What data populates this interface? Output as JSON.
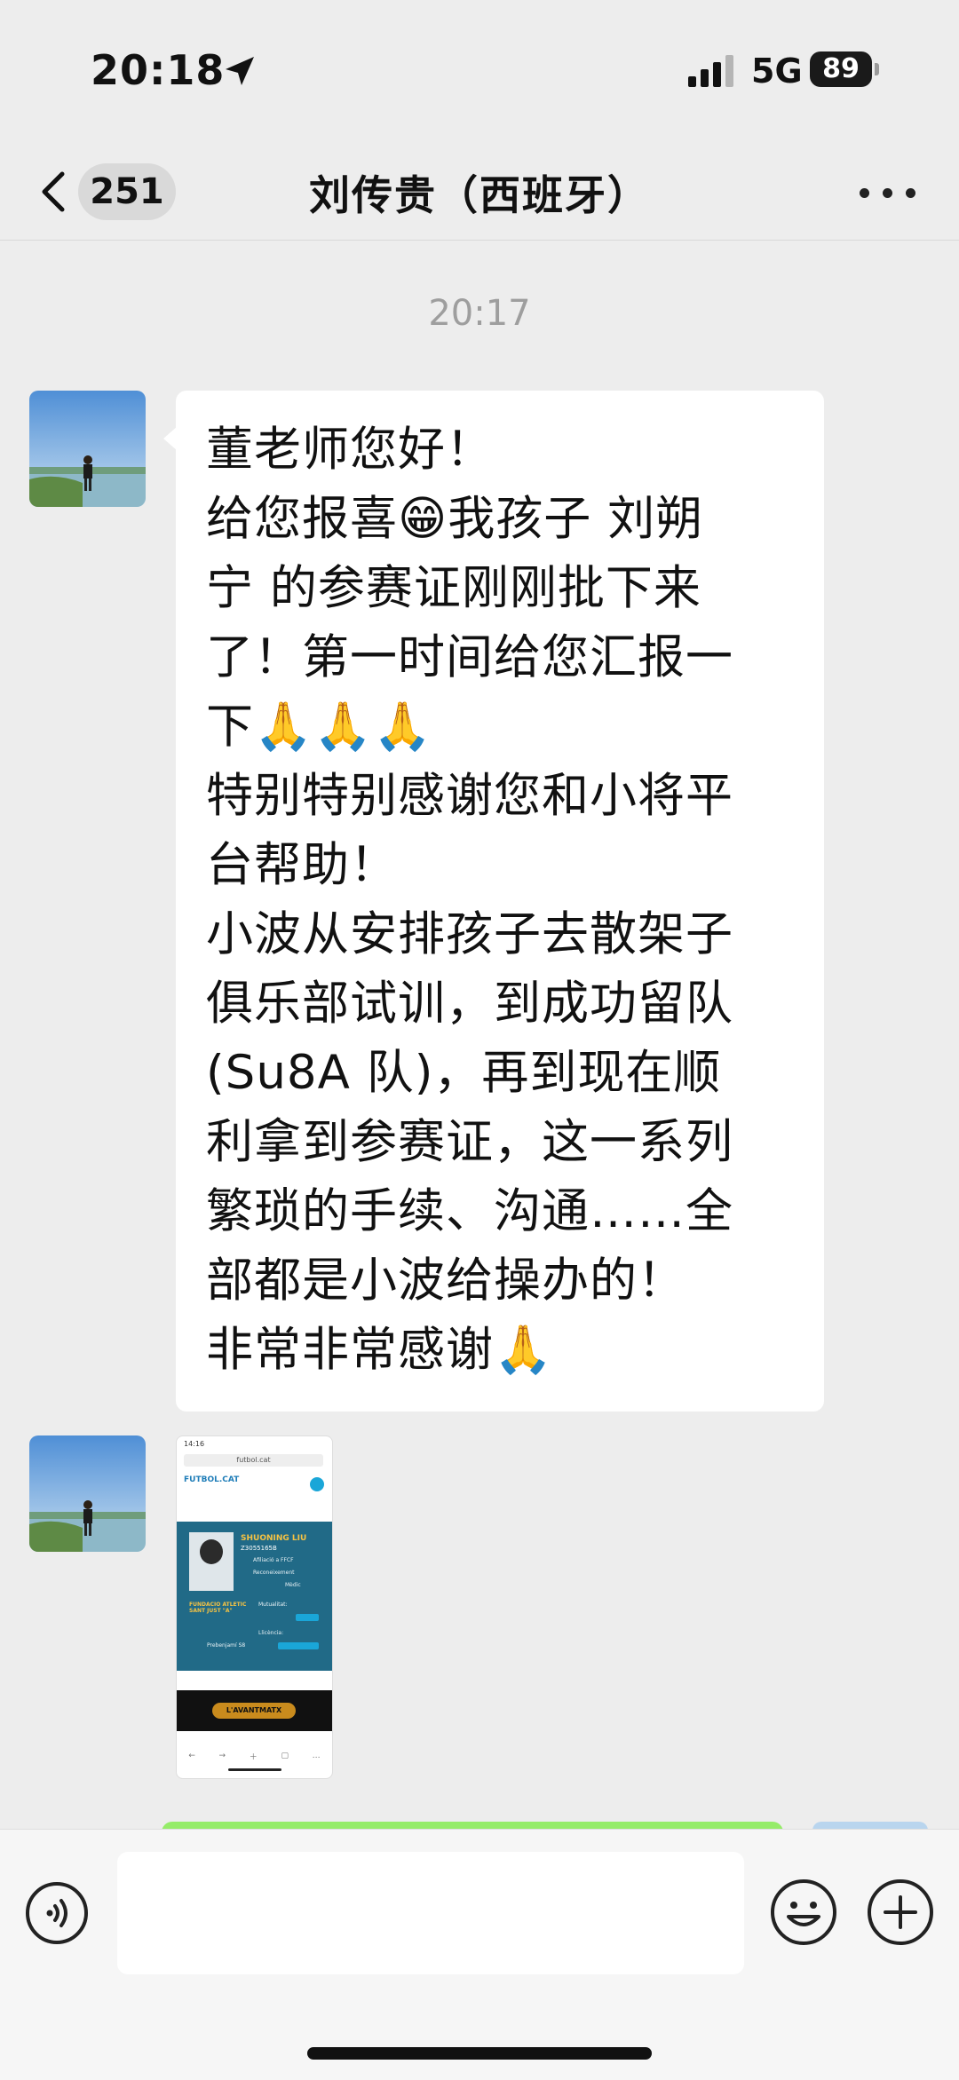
{
  "status_bar": {
    "time": "20:18",
    "network": "5G",
    "battery": "89"
  },
  "header": {
    "unread_count": "251",
    "title": "刘传贵（西班牙）"
  },
  "chat": {
    "timestamp": "20:17",
    "message_lines": [
      "董老师您好！",
      "给您报喜😁我孩子 刘朔",
      "宁 的参赛证刚刚批下来",
      "了！第一时间给您汇报一",
      "下🙏🙏🙏",
      "特别特别感谢您和小将平",
      "台帮助！",
      "小波从安排孩子去散架子",
      "俱乐部试训，到成功留队",
      "(Su8A 队)，再到现在顺",
      "利拿到参赛证，这一系列",
      "繁琐的手续、沟通……全",
      "部都是小波给操办的！",
      "非常非常感谢🙏"
    ],
    "image_thumbnail": {
      "status_time": "14:16",
      "url": "futbol.cat",
      "site_name": "FUTBOL.CAT",
      "player_name": "SHUONING LIU",
      "player_id": "Z3055165B",
      "affiliation": "Afiliació a FFCF",
      "recognition": "Reconeixement",
      "medical": "Mèdic",
      "club": "FUNDACIO ATLETIC SANT JUST \"A\"",
      "mutualitat": "Mutualitat:",
      "category": "Prebenjamí S8",
      "licencia": "Llicència:",
      "banner": "L'AVANTMATX"
    }
  },
  "colors": {
    "background": "#ededed",
    "bubble_white": "#ffffff",
    "bubble_green": "#95ec69",
    "timestamp_gray": "#9e9e9e"
  }
}
